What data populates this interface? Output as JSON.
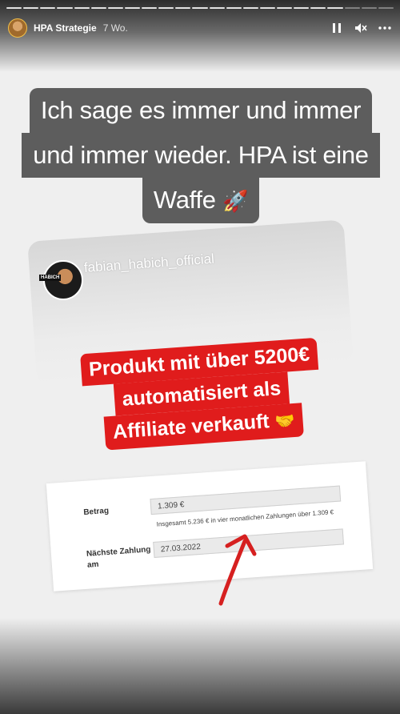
{
  "header": {
    "username": "HPA Strategie",
    "time_ago": "7 Wo.",
    "progress": {
      "total": 23,
      "current": 20
    },
    "icons": [
      "pause-icon",
      "mute-icon",
      "more-icon"
    ]
  },
  "caption": {
    "lines": [
      "Ich sage es immer und immer",
      "und immer wieder. HPA ist eine",
      "Waffe"
    ],
    "emoji": "🚀"
  },
  "shared_post": {
    "username": "fabian_habich_official",
    "avatar_tag": "HABICH"
  },
  "red_text": {
    "lines": [
      "Produkt mit über 5200€",
      "automatisiert als",
      "Affiliate verkauft"
    ],
    "emoji": "🤝"
  },
  "form": {
    "amount_label": "Betrag",
    "amount_value": "1.309 €",
    "note": "Insgesamt 5.236 € in vier monatlichen Zahlungen über 1.309 €",
    "next_label_line1": "Nächste Zahlung",
    "next_label_line2": "am",
    "next_value": "27.03.2022"
  },
  "colors": {
    "caption_bg": "#5d5d5d",
    "red_bg": "#e01c1c",
    "arrow": "#d62020"
  }
}
